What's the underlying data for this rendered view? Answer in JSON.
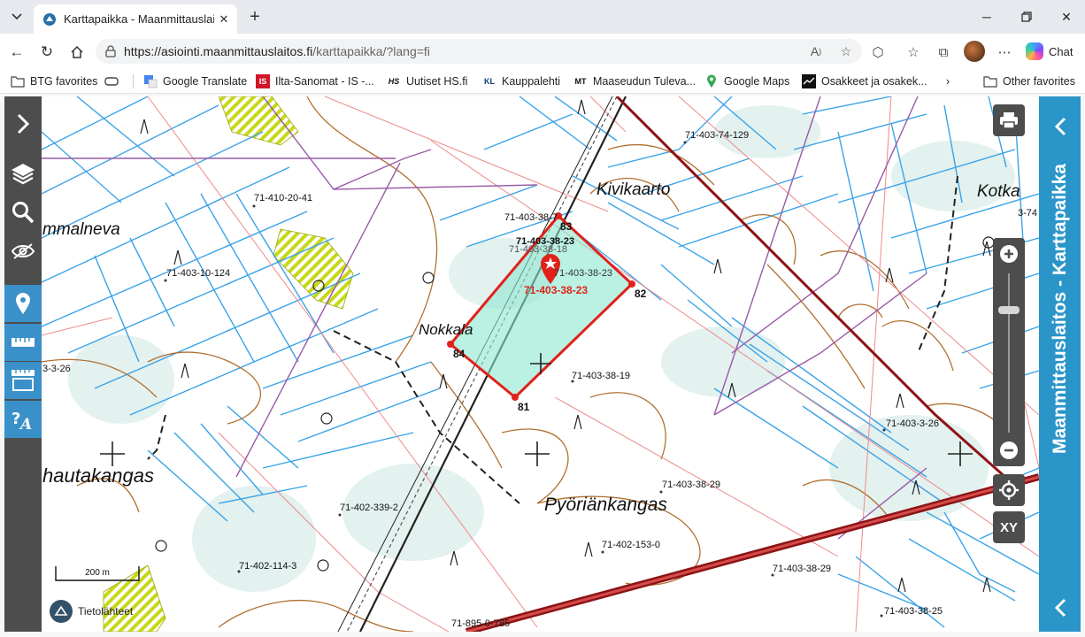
{
  "browser": {
    "tab_title": "Karttapaikka - Maanmittauslaitos",
    "url_host": "https://asiointi.maanmittauslaitos.fi",
    "url_path": "/karttapaikka/?lang=fi",
    "chat_label": "Chat",
    "bookmarks": [
      {
        "label": "BTG favorites",
        "icon": "folder-icon"
      },
      {
        "label": "Google Translate",
        "icon": "google-translate-icon"
      },
      {
        "label": "Ilta-Sanomat - IS -...",
        "icon": "is-icon"
      },
      {
        "label": "Uutiset  HS.fi",
        "icon": "hs-icon"
      },
      {
        "label": "Kauppalehti",
        "icon": "kl-icon"
      },
      {
        "label": "Maaseudun Tuleva...",
        "icon": "mt-icon"
      },
      {
        "label": "Google Maps",
        "icon": "maps-pin-icon"
      },
      {
        "label": "Osakkeet ja osakek...",
        "icon": "stock-chart-icon"
      }
    ],
    "other_favorites": "Other favorites",
    "bookmark_icon_text": {
      "hs": "HS",
      "kl": "KL",
      "mt": "MT",
      "is": "IS"
    }
  },
  "app": {
    "side_title": "Maanmittauslaitos - Karttapaikka",
    "xy_label": "XY",
    "scale_label": "200 m",
    "attribution": "Tietolähteet"
  },
  "map": {
    "place_names": {
      "kivikaarto": "Kivikaarto",
      "kotka": "Kotka",
      "mmalneva": "mmalneva",
      "nokkala": "Nokkala",
      "hautakangas": "hautakangas",
      "pyorian": "Pyöriänkangas"
    },
    "parcels": {
      "p1": "71-403-74-129",
      "p2": "71-410-20-41",
      "p3": "71-403-38-7",
      "p4": "71-403-38-23",
      "p5": "71-403-38-18",
      "p6": "71-403-38-23",
      "p7": "71-403-10-124",
      "p8": "3-3-26",
      "p9": "71-403-38-19",
      "p10": "71-403-3-26",
      "p11": "71-403-38-29",
      "p12": "71-402-339-2",
      "p13": "71-402-153-0",
      "p14": "71-402-114-3",
      "p15": "71-403-38-29",
      "p16": "71-403-38-25",
      "p17": "71-895-0-785",
      "p18": "3-74"
    },
    "selected_parcel": "71-403-38-23",
    "corner_points": {
      "c81": "81",
      "c82": "82",
      "c83": "83",
      "c84": "84"
    },
    "colors": {
      "parcel_outline": "#e0221a",
      "selection_fill": "#8ee8d0",
      "streams": "#3aa3e8",
      "contours": "#b07030",
      "road": "#8c1414",
      "wetland_hatch": "#c8d818"
    }
  }
}
